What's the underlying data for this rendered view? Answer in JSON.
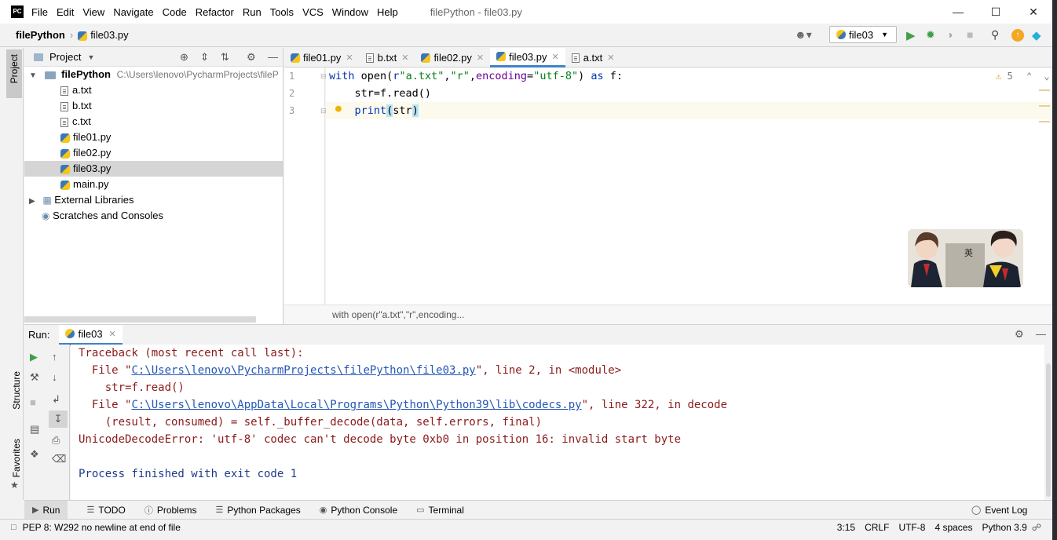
{
  "app": {
    "logo": "PC",
    "title": "filePython - file03.py",
    "menu": [
      "File",
      "Edit",
      "View",
      "Navigate",
      "Code",
      "Refactor",
      "Run",
      "Tools",
      "VCS",
      "Window",
      "Help"
    ]
  },
  "nav": {
    "project": "filePython",
    "file": "file03.py",
    "run_config": "file03"
  },
  "project_pane": {
    "header": "Project",
    "root_name": "filePython",
    "root_path": "C:\\Users\\lenovo\\PycharmProjects\\fileP",
    "files": [
      "a.txt",
      "b.txt",
      "c.txt",
      "file01.py",
      "file02.py",
      "file03.py",
      "main.py"
    ],
    "selected": "file03.py",
    "external": "External Libraries",
    "scratches": "Scratches and Consoles"
  },
  "side_tabs": {
    "project": "Project",
    "structure": "Structure",
    "favorites": "Favorites"
  },
  "editor": {
    "tabs": [
      "file01.py",
      "b.txt",
      "file02.py",
      "file03.py",
      "a.txt"
    ],
    "active_tab": "file03.py",
    "line_numbers": [
      "1",
      "2",
      "3"
    ],
    "warning_count": "5",
    "breadcrumb": "with open(r\"a.txt\",\"r\",encoding..."
  },
  "run_panel": {
    "label": "Run:",
    "tab": "file03",
    "lines": {
      "l1": "Traceback (most recent call last):",
      "l2a": "  File \"",
      "l2link": "C:\\Users\\lenovo\\PycharmProjects\\filePython\\file03.py",
      "l2b": "\", line 2, in <module>",
      "l3": "    str=f.read()",
      "l4a": "  File \"",
      "l4link": "C:\\Users\\lenovo\\AppData\\Local\\Programs\\Python\\Python39\\lib\\codecs.py",
      "l4b": "\", line 322, in decode",
      "l5": "    (result, consumed) = self._buffer_decode(data, self.errors, final)",
      "l6": "UnicodeDecodeError: 'utf-8' codec can't decode byte 0xb0 in position 16: invalid start byte",
      "l8": "Process finished with exit code 1"
    }
  },
  "tool_windows": [
    "Run",
    "TODO",
    "Problems",
    "Python Packages",
    "Python Console",
    "Terminal"
  ],
  "event_log": "Event Log",
  "status": {
    "message": "PEP 8: W292 no newline at end of file",
    "position": "3:15",
    "line_sep": "CRLF",
    "encoding": "UTF-8",
    "indent": "4 spaces",
    "interpreter": "Python 3.9"
  },
  "sticker": {
    "text": "英"
  },
  "colors": {
    "accent": "#4083c9",
    "error_text": "#8b1a1a",
    "link": "#2457b6",
    "keyword": "#0033b3",
    "string": "#067d17"
  }
}
